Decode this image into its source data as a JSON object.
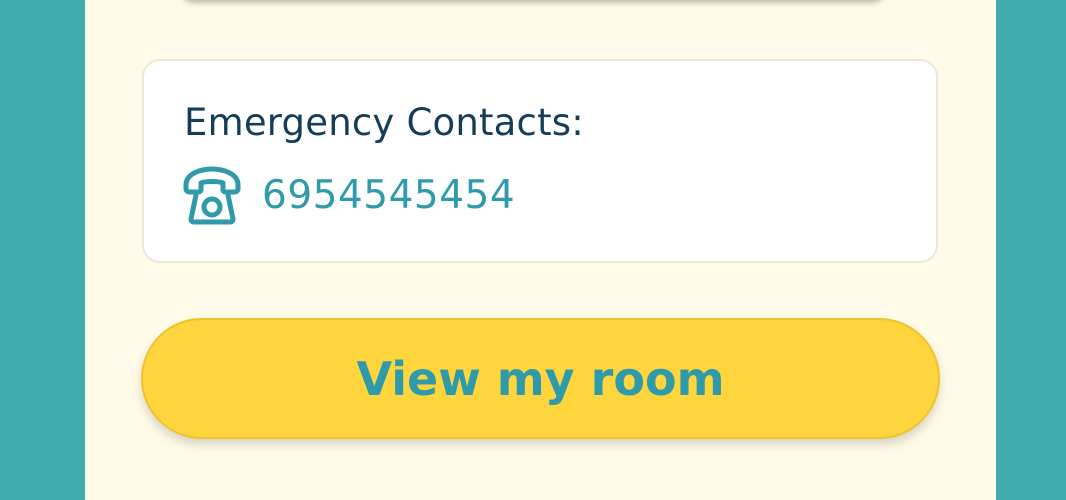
{
  "emergency": {
    "title": "Emergency Contacts:",
    "icon": "telephone-icon",
    "phone": "6954545454"
  },
  "actions": {
    "view_room_label": "View my room"
  },
  "colors": {
    "outer_background": "#40aeae",
    "panel_background": "#fffbe8",
    "card_background": "#ffffff",
    "title_text": "#153d58",
    "accent_teal": "#2f9aaa",
    "button_yellow": "#ffd53d"
  }
}
